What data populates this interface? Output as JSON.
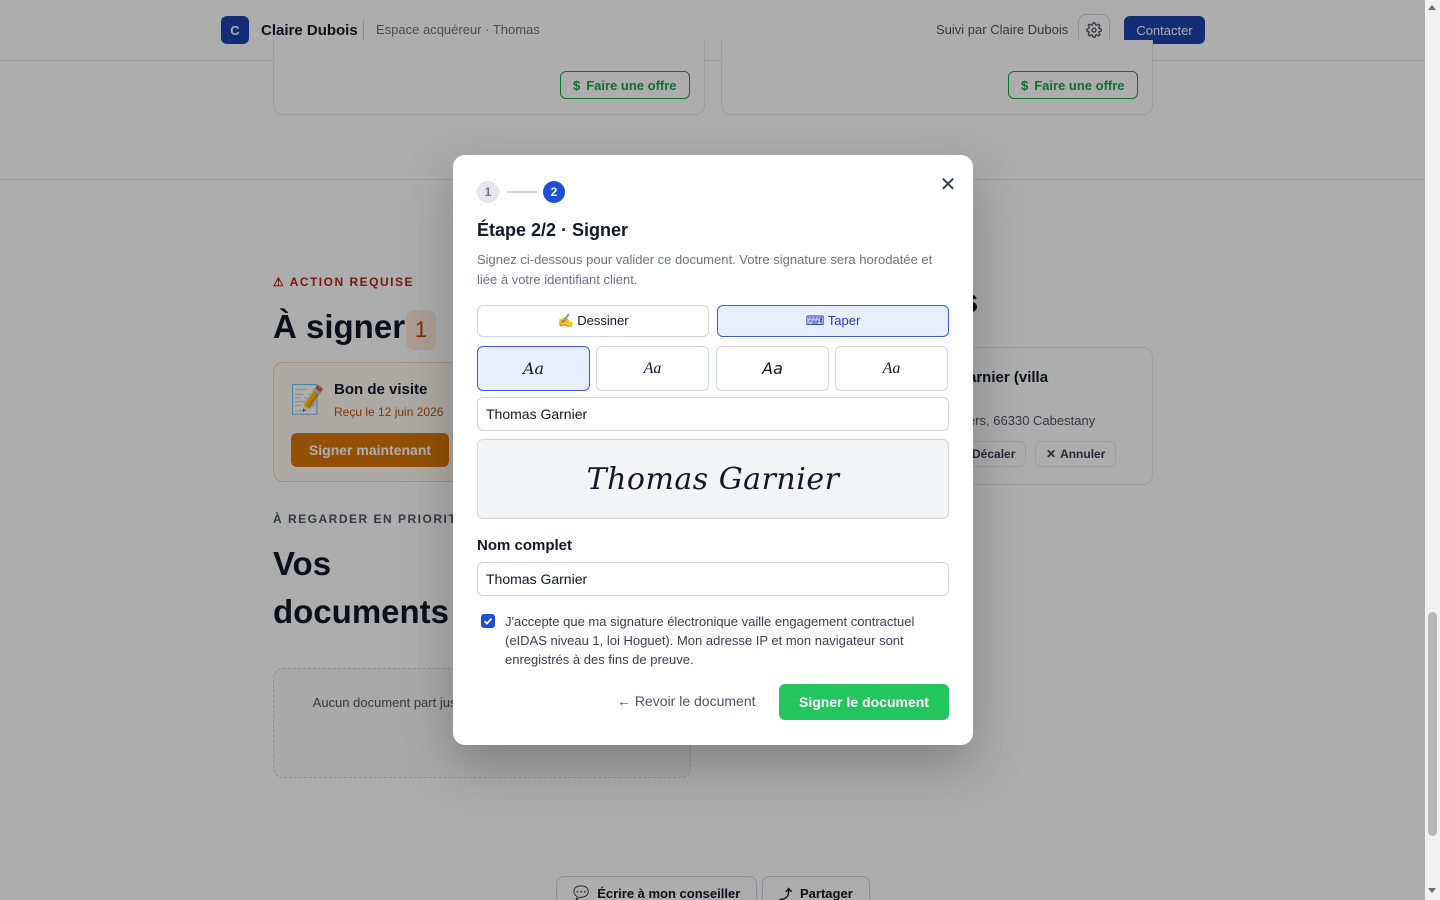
{
  "header": {
    "brand_initial": "C",
    "brand_name": "Claire Dubois",
    "subtitle": "Espace acquéreur · Thomas",
    "followed_by": "Suivi par Claire Dubois",
    "contact_label": "Contacter"
  },
  "top_cards": {
    "offer_label": "Faire une offre"
  },
  "to_sign": {
    "alert_label": "⚠ ACTION REQUISE",
    "title": "À signer",
    "count": "1",
    "doc_name": "Bon de visite",
    "doc_date": "Reçu le 12 juin 2026",
    "sign_now_label": "Signer maintenant"
  },
  "documents": {
    "priority_label": "À REGARDER EN PRIORITÉ",
    "title": "Vos documents",
    "empty_text": "Aucun document part justificatifs (pièce d'ide paie...) pour a"
  },
  "visit": {
    "section_title_fragment": "s",
    "name_fragment": "arnier (villa",
    "address_fragment": "ers, 66330 Cabestany",
    "reschedule_label": "Décaler",
    "cancel_label": "Annuler"
  },
  "footer": {
    "write_label": "Écrire à mon conseiller",
    "share_label": "Partager"
  },
  "modal": {
    "step1": "1",
    "step2": "2",
    "title": "Étape 2/2 · Signer",
    "description": "Signez ci-dessous pour valider ce document. Votre signature sera horodatée et liée à votre identifiant client.",
    "tab_draw": "✍️ Dessiner",
    "tab_type": "⌨ Taper",
    "font_options": [
      "Aa",
      "Aa",
      "Aa",
      "Aa"
    ],
    "typed_value": "Thomas Garnier",
    "preview_text": "Thomas Garnier",
    "full_name_label": "Nom complet",
    "full_name_value": "Thomas Garnier",
    "consent_text": "J'accepte que ma signature électronique vaille engagement contractuel (eIDAS niveau 1, loi Hoguet). Mon adresse IP et mon navigateur sont enregistrés à des fins de preuve.",
    "consent_checked": true,
    "back_label": "← Revoir le document",
    "submit_label": "Signer le document"
  },
  "colors": {
    "primary": "#1e40af",
    "accent_blue": "#1d4ed8",
    "success": "#22c55e",
    "warning": "#d97706"
  }
}
